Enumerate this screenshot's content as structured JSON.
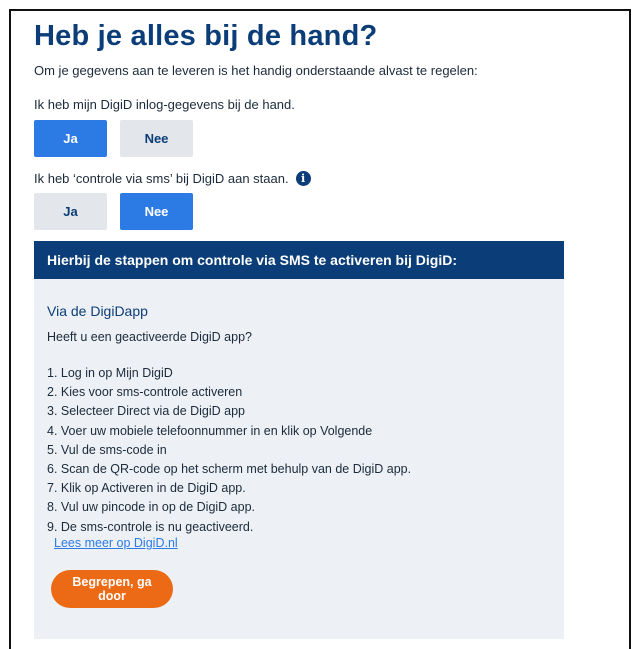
{
  "page": {
    "title": "Heb je alles bij de hand?",
    "intro": "Om je gegevens aan te leveren is het handig onderstaande alvast te regelen:"
  },
  "question_login": {
    "label": "Ik heb mijn DigiD inlog-gegevens bij de hand.",
    "yes_label": "Ja",
    "no_label": "Nee",
    "selected": "Ja"
  },
  "question_sms": {
    "label": "Ik heb ‘controle via sms’ bij DigiD aan staan.",
    "info_icon": "info-icon",
    "yes_label": "Ja",
    "no_label": "Nee",
    "selected": "Nee"
  },
  "panel": {
    "header": "Hierbij de stappen om controle via SMS te activeren bij DigiD:",
    "section_title": "Via de DigiDapp",
    "question": "Heeft u een geactiveerde DigiD app?",
    "steps": [
      "1. Log in op Mijn DigiD",
      "2. Kies voor sms-controle activeren",
      "3. Selecteer Direct via de DigiD app",
      "4. Voer uw mobiele telefoonnummer in en klik op Volgende",
      "5. Vul de sms-code in",
      "6. Scan de QR-code op het scherm met behulp van de DigiD app.",
      "7. Klik op Activeren in de DigiD app.",
      "8. Vul uw pincode in op de DigiD app.",
      "9. De sms-controle is nu geactiveerd."
    ],
    "link": "Lees meer op DigiD.nl",
    "cta": "Begrepen, ga door"
  },
  "colors": {
    "primary_navy": "#0b3d78",
    "active_blue": "#2c7be5",
    "inactive_gray": "#e3e6ea",
    "panel_bg": "#edf1f5",
    "cta_orange": "#ec6a16"
  }
}
